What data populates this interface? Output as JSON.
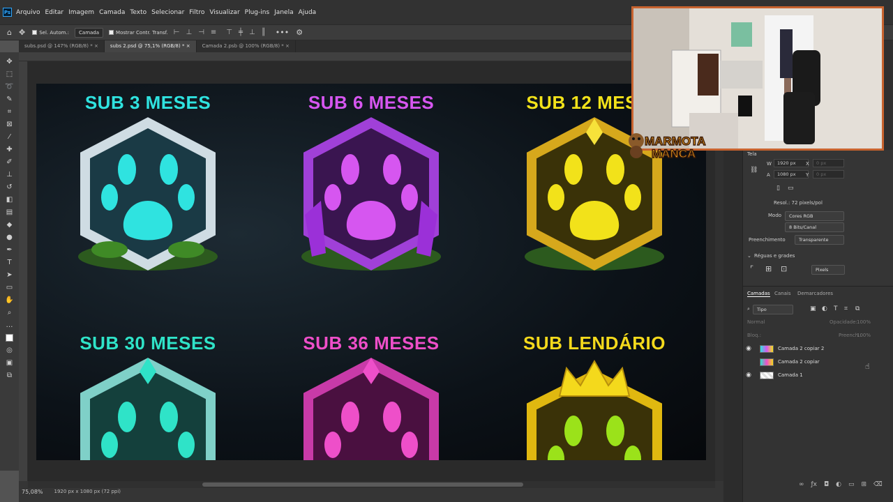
{
  "menubar": {
    "items": [
      "Arquivo",
      "Editar",
      "Imagem",
      "Camada",
      "Texto",
      "Selecionar",
      "Filtro",
      "Visualizar",
      "Plug-ins",
      "Janela",
      "Ajuda"
    ]
  },
  "options_bar": {
    "auto_select_label": "Sel. Autom.:",
    "auto_select_value": "Camada",
    "show_transform_label": "Mostrar Contr. Transf."
  },
  "tabs": [
    {
      "label": "subs.psd @ 147% (RGB/8) *",
      "active": false
    },
    {
      "label": "subs 2.psd @ 75,1% (RGB/8) *",
      "active": true
    },
    {
      "label": "Camada 2.psb @ 100% (RGB/8) *",
      "active": false
    }
  ],
  "canvas": {
    "badges": [
      {
        "title": "SUB 3 MESES",
        "color": "#2fe3e0",
        "accent": "#bfd2da"
      },
      {
        "title": "SUB 6 MESES",
        "color": "#d656f0",
        "accent": "#a040d8"
      },
      {
        "title": "SUB 12 MESES",
        "color": "#f2e21a",
        "accent": "#d6a81c"
      },
      {
        "title": "SUB 30 MESES",
        "color": "#2fe3c8",
        "accent": "#7fd0c8"
      },
      {
        "title": "SUB 36 MESES",
        "color": "#ee4fc9",
        "accent": "#c83aa8"
      },
      {
        "title": "SUB LENDÁRIO",
        "color": "#f4d91c",
        "accent": "#e0b810"
      }
    ]
  },
  "status": {
    "zoom": "75,08%",
    "doc_info": "1920 px x 1080 px (72 ppi)"
  },
  "properties": {
    "section_canvas": "Tela",
    "w_label": "W",
    "w_value": "1920 px",
    "h_label": "A",
    "h_value": "1080 px",
    "x_label": "X",
    "x_value": "0 px",
    "y_label": "Y",
    "y_value": "0 px",
    "resolution": "Resol.: 72 pixels/pol",
    "mode_label": "Modo",
    "mode_value": "Cores RGB",
    "depth_value": "8 Bits/Canal",
    "fill_label": "Preenchimento",
    "fill_value": "Transparente",
    "rulers_header": "Réguas e grades",
    "units_value": "Pixels"
  },
  "layers_panel": {
    "tabs": [
      "Camadas",
      "Canais",
      "Demarcadores"
    ],
    "filter_label": "Tipo",
    "blend_mode": "Normal",
    "opacity_label": "Opacidade:",
    "opacity_value": "100%",
    "lock_label": "Bloq.:",
    "fill_label": "Preench.:",
    "fill_value": "100%",
    "layers": [
      {
        "name": "Camada 2 copiar 2",
        "visible": true
      },
      {
        "name": "Camada 2 copiar",
        "visible": false
      },
      {
        "name": "Camada 1",
        "visible": true
      }
    ]
  },
  "webcam": {
    "logo_line1": "MARMOTA",
    "logo_line2": "MANCA",
    "border_color": "#c8632f"
  }
}
